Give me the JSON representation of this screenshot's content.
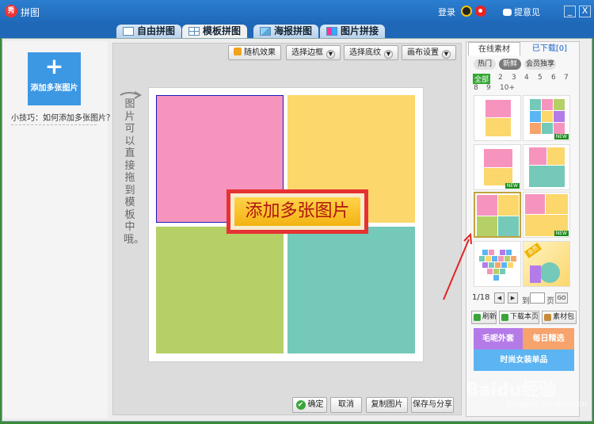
{
  "window": {
    "logo_text": "秀",
    "title": "拼图",
    "login": "登录",
    "feedback": "提意见",
    "minimize": "_",
    "close": "X"
  },
  "tabs": [
    {
      "label": "自由拼图",
      "icon": "free-collage-icon"
    },
    {
      "label": "模板拼图",
      "icon": "template-grid-icon",
      "active": true
    },
    {
      "label": "海报拼图",
      "icon": "poster-icon"
    },
    {
      "label": "图片拼接",
      "icon": "splice-icon"
    }
  ],
  "left_panel": {
    "add_plus": "+",
    "add_label": "添加多张图片",
    "tip": "小技巧：如何添加多张图片？"
  },
  "toolbar": {
    "random": "随机效果",
    "border": "选择边框",
    "texture": "选择底纹",
    "canvas": "画布设置"
  },
  "canvas": {
    "hint": "图片可以直接拖到模板中哦。",
    "callout": "添加多张图片",
    "cell_colors": [
      "#f694be",
      "#fbd76c",
      "#b4d067",
      "#74c9b8"
    ]
  },
  "bottom_buttons": {
    "ok": "确定",
    "cancel": "取消",
    "copy": "复制图片",
    "save": "保存与分享"
  },
  "right_panel": {
    "tab_online": "在线素材",
    "tab_downloaded": "已下载[0]",
    "filter_hot": "热门",
    "filter_new": "新鲜",
    "filter_member": "会员独享",
    "counts": [
      "全部",
      "2",
      "3",
      "4",
      "5",
      "6",
      "7",
      "8",
      "9",
      "10+"
    ],
    "new_badge": "NEW",
    "member_badge": "会员",
    "pager": {
      "page": "1/18",
      "to": "到",
      "unit": "页",
      "go": "GO"
    },
    "refresh": "刷新",
    "download_page": "下载本页",
    "pack": "素材包",
    "banner": {
      "purple": "毛呢外套",
      "orange": "每日精选",
      "blue": "时尚女装单品"
    }
  },
  "watermark": {
    "main": "Baidu经验",
    "sub": "jingyan.baidu.com"
  }
}
